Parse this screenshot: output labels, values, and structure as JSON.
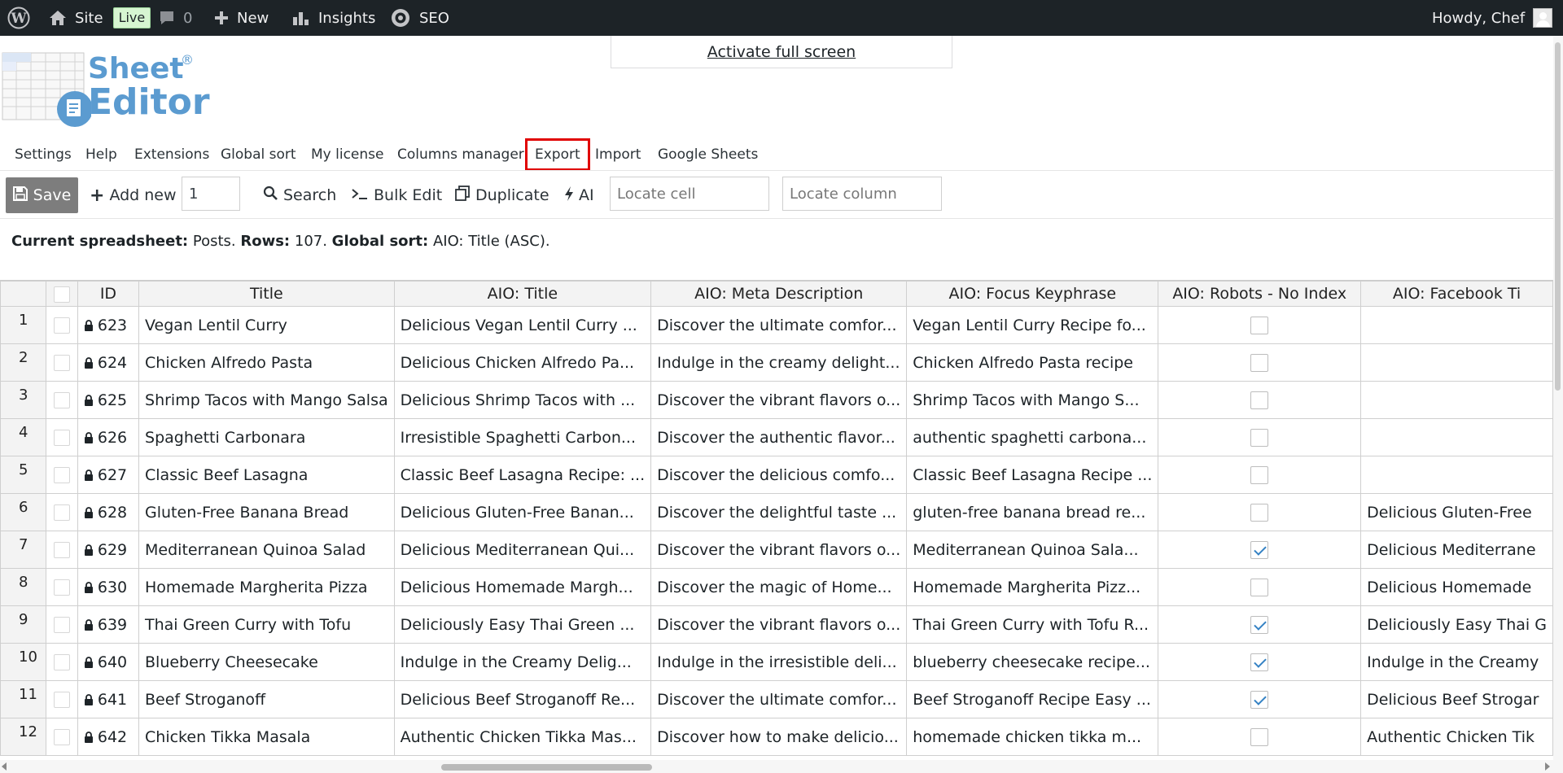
{
  "admin_bar": {
    "wp_logo_icon": "wordpress-logo-icon",
    "site_label": "Site",
    "live_badge": "Live",
    "comments_count": "0",
    "new_label": "New",
    "insights_label": "Insights",
    "seo_label": "SEO",
    "greeting": "Howdy, Chef"
  },
  "fullscreen_link": "Activate full screen",
  "logo": {
    "line1": "Sheet",
    "line2": "Editor",
    "reg": "®"
  },
  "top_menu": [
    "Settings",
    "Help",
    "Extensions",
    "Global sort",
    "My license",
    "Columns manager",
    "Export",
    "Import",
    "Google Sheets"
  ],
  "highlighted_menu_item": "Export",
  "toolbar": {
    "save_label": "Save",
    "add_new_label": "Add new",
    "add_new_count": "1",
    "search_label": "Search",
    "bulk_edit_label": "Bulk Edit",
    "duplicate_label": "Duplicate",
    "ai_label": "AI",
    "locate_cell_placeholder": "Locate cell",
    "locate_column_placeholder": "Locate column"
  },
  "status": {
    "spreadsheet_key": "Current spreadsheet:",
    "spreadsheet_val": " Posts. ",
    "rows_key": "Rows:",
    "rows_val": " 107. ",
    "sort_key": "Global sort:",
    "sort_val": " AIO: Title (ASC)."
  },
  "grid": {
    "columns": [
      "ID",
      "Title",
      "AIO: Title",
      "AIO: Meta Description",
      "AIO: Focus Keyphrase",
      "AIO: Robots - No Index",
      "AIO: Facebook Ti"
    ],
    "rows": [
      {
        "num": "1",
        "id": "623",
        "title": "Vegan Lentil Curry",
        "aio_title": "Delicious Vegan Lentil Curry ...",
        "meta": "Discover the ultimate comfor...",
        "keyphrase": "Vegan Lentil Curry Recipe fo...",
        "noindex": false,
        "fb_title": ""
      },
      {
        "num": "2",
        "id": "624",
        "title": "Chicken Alfredo Pasta",
        "aio_title": "Delicious Chicken Alfredo Pa...",
        "meta": "Indulge in the creamy delight...",
        "keyphrase": "Chicken Alfredo Pasta recipe",
        "noindex": false,
        "fb_title": ""
      },
      {
        "num": "3",
        "id": "625",
        "title": "Shrimp Tacos with Mango Salsa",
        "aio_title": "Delicious Shrimp Tacos with ...",
        "meta": "Discover the vibrant flavors o...",
        "keyphrase": "Shrimp Tacos with Mango S...",
        "noindex": false,
        "fb_title": ""
      },
      {
        "num": "4",
        "id": "626",
        "title": "Spaghetti Carbonara",
        "aio_title": "Irresistible Spaghetti Carbon...",
        "meta": "Discover the authentic flavor...",
        "keyphrase": "authentic spaghetti carbona...",
        "noindex": false,
        "fb_title": ""
      },
      {
        "num": "5",
        "id": "627",
        "title": "Classic Beef Lasagna",
        "aio_title": "Classic Beef Lasagna Recipe: ...",
        "meta": "Discover the delicious comfo...",
        "keyphrase": "Classic Beef Lasagna Recipe ...",
        "noindex": false,
        "fb_title": ""
      },
      {
        "num": "6",
        "id": "628",
        "title": "Gluten-Free Banana Bread",
        "aio_title": "Delicious Gluten-Free Banan...",
        "meta": "Discover the delightful taste ...",
        "keyphrase": "gluten-free banana bread re...",
        "noindex": false,
        "fb_title": "Delicious Gluten-Free"
      },
      {
        "num": "7",
        "id": "629",
        "title": "Mediterranean Quinoa Salad",
        "aio_title": "Delicious Mediterranean Qui...",
        "meta": "Discover the vibrant flavors o...",
        "keyphrase": "Mediterranean Quinoa Sala...",
        "noindex": true,
        "fb_title": "Delicious Mediterrane"
      },
      {
        "num": "8",
        "id": "630",
        "title": "Homemade Margherita Pizza",
        "aio_title": "Delicious Homemade Margh...",
        "meta": "Discover the magic of Home...",
        "keyphrase": "Homemade Margherita Pizz...",
        "noindex": false,
        "fb_title": "Delicious Homemade"
      },
      {
        "num": "9",
        "id": "639",
        "title": "Thai Green Curry with Tofu",
        "aio_title": "Deliciously Easy Thai Green ...",
        "meta": "Discover the vibrant flavors o...",
        "keyphrase": "Thai Green Curry with Tofu R...",
        "noindex": true,
        "fb_title": "Deliciously Easy Thai G"
      },
      {
        "num": "10",
        "id": "640",
        "title": "Blueberry Cheesecake",
        "aio_title": "Indulge in the Creamy Delig...",
        "meta": "Indulge in the irresistible deli...",
        "keyphrase": "blueberry cheesecake recipe...",
        "noindex": true,
        "fb_title": "Indulge in the Creamy"
      },
      {
        "num": "11",
        "id": "641",
        "title": "Beef Stroganoff",
        "aio_title": "Delicious Beef Stroganoff Re...",
        "meta": "Discover the ultimate comfor...",
        "keyphrase": "Beef Stroganoff Recipe Easy ...",
        "noindex": true,
        "fb_title": "Delicious Beef Strogar"
      },
      {
        "num": "12",
        "id": "642",
        "title": "Chicken Tikka Masala",
        "aio_title": "Authentic Chicken Tikka Mas...",
        "meta": "Discover how to make delicio...",
        "keyphrase": "homemade chicken tikka m...",
        "noindex": false,
        "fb_title": "Authentic Chicken Tik"
      }
    ]
  },
  "colors": {
    "admin_bar_bg": "#1d2327",
    "logo_blue": "#5b9bd0",
    "highlight_red": "#e00000",
    "save_bg": "#7d7d7d",
    "checkbox_check": "#3582c4"
  }
}
